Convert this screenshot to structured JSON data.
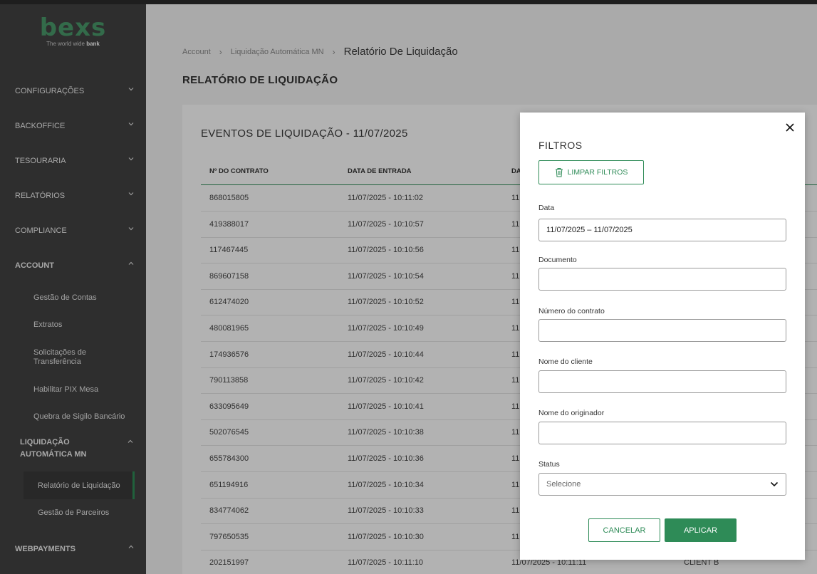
{
  "brand": {
    "logo": "bexs",
    "tagline_prefix": "The world wide",
    "tagline_bold": "bank"
  },
  "sidebar": {
    "items": [
      {
        "label": "CONFIGURAÇÕES",
        "chevron": "down"
      },
      {
        "label": "BACKOFFICE",
        "chevron": "down"
      },
      {
        "label": "TESOURARIA",
        "chevron": "down"
      },
      {
        "label": "RELATÓRIOS",
        "chevron": "down"
      },
      {
        "label": "COMPLIANCE",
        "chevron": "down"
      },
      {
        "label": "ACCOUNT",
        "chevron": "up"
      }
    ],
    "account_sub": [
      "Gestão de Contas",
      "Extratos",
      "Solicitações de Transferência",
      "Habilitar PIX Mesa",
      "Quebra de Sigilo Bancário"
    ],
    "liquidacao_group": "LIQUIDAÇÃO AUTOMÁTICA MN",
    "liquidacao_sub": [
      "Relatório de Liquidação",
      "Gestão de Parceiros"
    ],
    "webpayments": "WEBPAYMENTS"
  },
  "breadcrumb": [
    "Account",
    "Liquidação Automática MN",
    "Relatório De Liquidação"
  ],
  "page_title": "RELATÓRIO DE LIQUIDAÇÃO",
  "card": {
    "title": "EVENTOS DE LIQUIDAÇÃO - 11/07/2025",
    "columns": [
      "Nº DO CONTRATO",
      "DATA DE ENTRADA",
      "DA"
    ],
    "rows": [
      [
        "868015805",
        "11/07/2025 - 10:11:02",
        "11",
        ""
      ],
      [
        "419388017",
        "11/07/2025 - 10:10:57",
        "11",
        ""
      ],
      [
        "117467445",
        "11/07/2025 - 10:10:56",
        "11",
        ""
      ],
      [
        "869607158",
        "11/07/2025 - 10:10:54",
        "11",
        ""
      ],
      [
        "612474020",
        "11/07/2025 - 10:10:52",
        "11",
        ""
      ],
      [
        "480081965",
        "11/07/2025 - 10:10:49",
        "11",
        ""
      ],
      [
        "174936576",
        "11/07/2025 - 10:10:44",
        "11",
        ""
      ],
      [
        "790113858",
        "11/07/2025 - 10:10:42",
        "11",
        ""
      ],
      [
        "633095649",
        "11/07/2025 - 10:10:41",
        "11",
        ""
      ],
      [
        "502076545",
        "11/07/2025 - 10:10:38",
        "11",
        ""
      ],
      [
        "655784300",
        "11/07/2025 - 10:10:36",
        "11",
        ""
      ],
      [
        "651194916",
        "11/07/2025 - 10:10:34",
        "11",
        ""
      ],
      [
        "834774062",
        "11/07/2025 - 10:10:33",
        "11",
        ""
      ],
      [
        "797650535",
        "11/07/2025 - 10:10:30",
        "11",
        ""
      ],
      [
        "202151997",
        "11/07/2025 - 10:11:10",
        "11/07/2025 - 10:11:11",
        "CLIENT B"
      ]
    ]
  },
  "modal": {
    "title": "FILTROS",
    "clear_label": "LIMPAR FILTROS",
    "fields": {
      "data_label": "Data",
      "data_value": "11/07/2025 – 11/07/2025",
      "documento_label": "Documento",
      "contrato_label": "Número do contrato",
      "cliente_label": "Nome do cliente",
      "originador_label": "Nome do originador",
      "status_label": "Status",
      "status_placeholder": "Selecione"
    },
    "cancel_label": "CANCELAR",
    "apply_label": "APLICAR"
  },
  "colors": {
    "accent": "#2e8b57",
    "sidebar_bg": "#434343"
  }
}
